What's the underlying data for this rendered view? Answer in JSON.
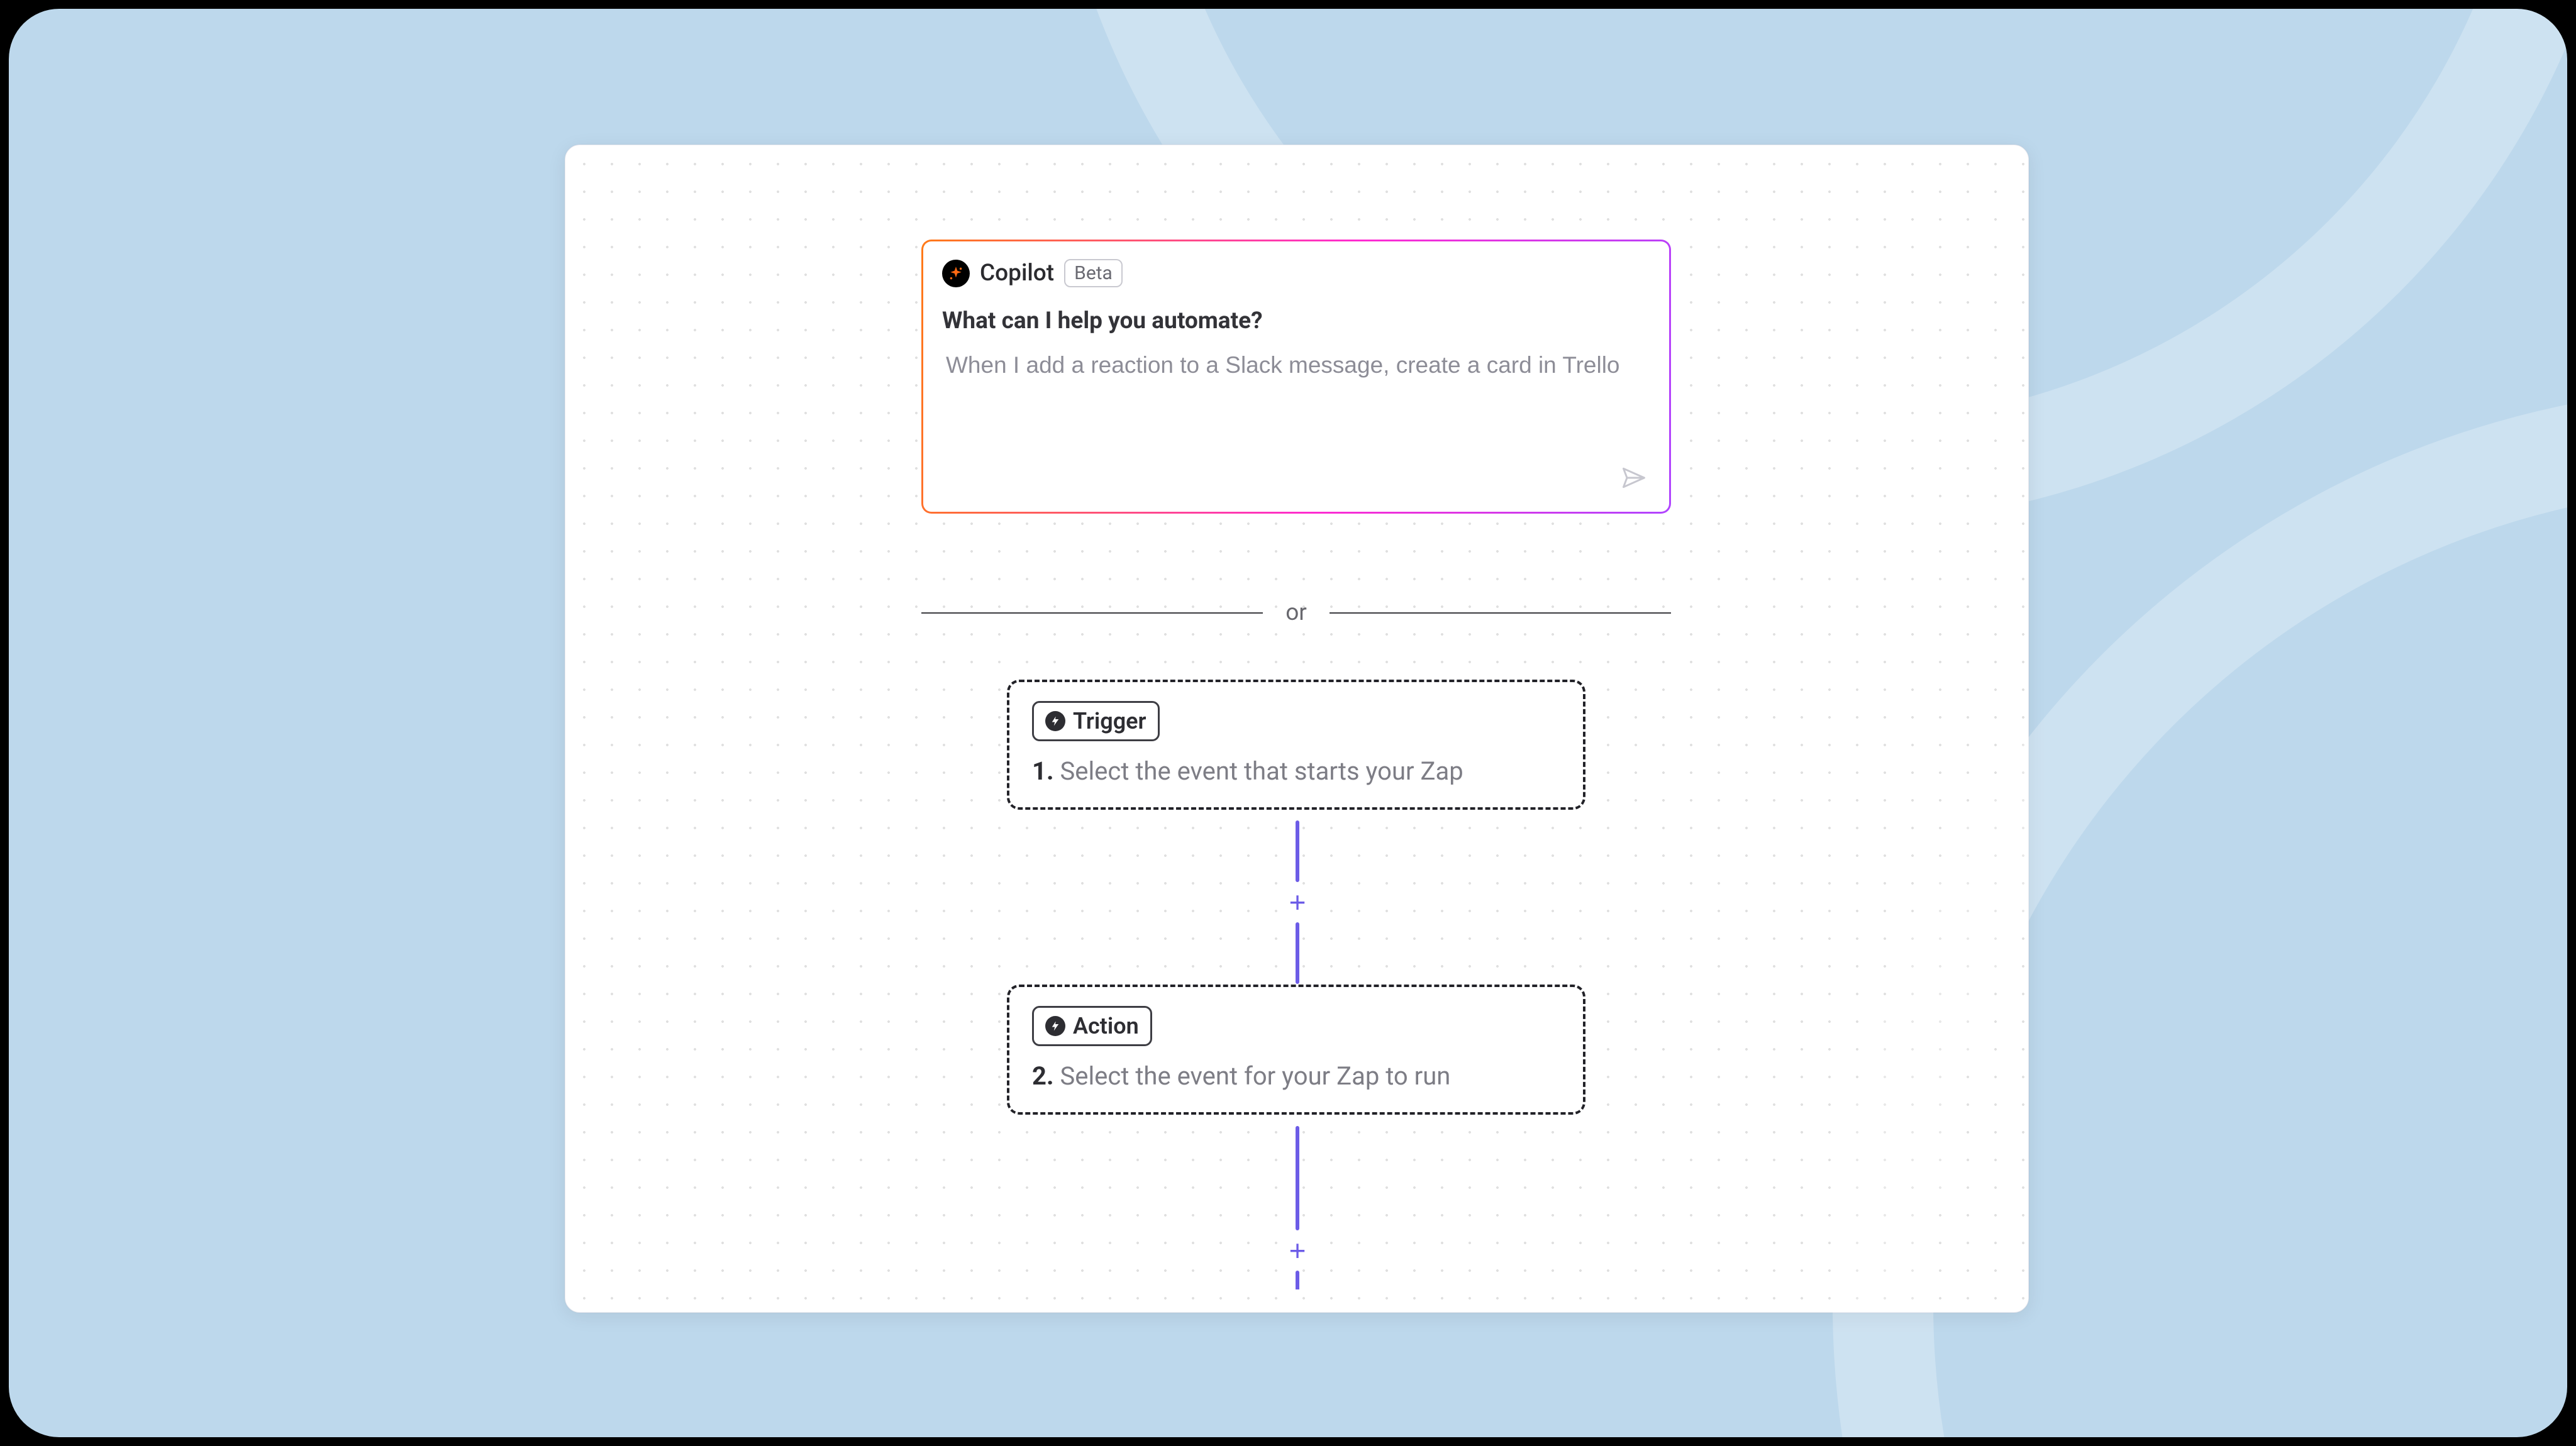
{
  "colors": {
    "page_bg": "#bdd8ec",
    "accent": "#6c5ce7",
    "gradient_start": "#ff7a18",
    "gradient_mid": "#ff2bd1",
    "gradient_end": "#b044ff"
  },
  "copilot": {
    "title": "Copilot",
    "badge": "Beta",
    "prompt": "What can I help you automate?",
    "placeholder": "When I add a reaction to a Slack message, create a card in Trello",
    "icon_name": "sparkle-icon",
    "send_icon_name": "send-icon"
  },
  "divider": {
    "label": "or"
  },
  "steps": [
    {
      "key": "trigger",
      "pill_label": "Trigger",
      "number": "1.",
      "description": "Select the event that starts your Zap",
      "icon_name": "bolt-icon"
    },
    {
      "key": "action",
      "pill_label": "Action",
      "number": "2.",
      "description": "Select the event for your Zap to run",
      "icon_name": "bolt-icon"
    }
  ],
  "add_step_label": "+"
}
